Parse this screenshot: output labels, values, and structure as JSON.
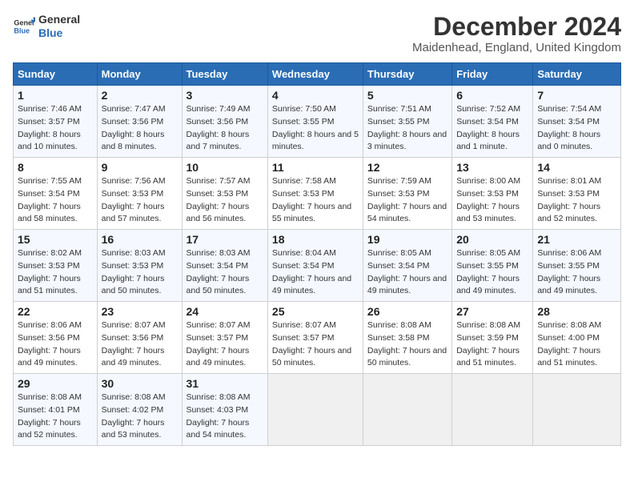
{
  "logo": {
    "line1": "General",
    "line2": "Blue"
  },
  "title": "December 2024",
  "subtitle": "Maidenhead, England, United Kingdom",
  "headers": [
    "Sunday",
    "Monday",
    "Tuesday",
    "Wednesday",
    "Thursday",
    "Friday",
    "Saturday"
  ],
  "weeks": [
    [
      {
        "day": "1",
        "sunrise": "7:46 AM",
        "sunset": "3:57 PM",
        "daylight": "8 hours and 10 minutes."
      },
      {
        "day": "2",
        "sunrise": "7:47 AM",
        "sunset": "3:56 PM",
        "daylight": "8 hours and 8 minutes."
      },
      {
        "day": "3",
        "sunrise": "7:49 AM",
        "sunset": "3:56 PM",
        "daylight": "8 hours and 7 minutes."
      },
      {
        "day": "4",
        "sunrise": "7:50 AM",
        "sunset": "3:55 PM",
        "daylight": "8 hours and 5 minutes."
      },
      {
        "day": "5",
        "sunrise": "7:51 AM",
        "sunset": "3:55 PM",
        "daylight": "8 hours and 3 minutes."
      },
      {
        "day": "6",
        "sunrise": "7:52 AM",
        "sunset": "3:54 PM",
        "daylight": "8 hours and 1 minute."
      },
      {
        "day": "7",
        "sunrise": "7:54 AM",
        "sunset": "3:54 PM",
        "daylight": "8 hours and 0 minutes."
      }
    ],
    [
      {
        "day": "8",
        "sunrise": "7:55 AM",
        "sunset": "3:54 PM",
        "daylight": "7 hours and 58 minutes."
      },
      {
        "day": "9",
        "sunrise": "7:56 AM",
        "sunset": "3:53 PM",
        "daylight": "7 hours and 57 minutes."
      },
      {
        "day": "10",
        "sunrise": "7:57 AM",
        "sunset": "3:53 PM",
        "daylight": "7 hours and 56 minutes."
      },
      {
        "day": "11",
        "sunrise": "7:58 AM",
        "sunset": "3:53 PM",
        "daylight": "7 hours and 55 minutes."
      },
      {
        "day": "12",
        "sunrise": "7:59 AM",
        "sunset": "3:53 PM",
        "daylight": "7 hours and 54 minutes."
      },
      {
        "day": "13",
        "sunrise": "8:00 AM",
        "sunset": "3:53 PM",
        "daylight": "7 hours and 53 minutes."
      },
      {
        "day": "14",
        "sunrise": "8:01 AM",
        "sunset": "3:53 PM",
        "daylight": "7 hours and 52 minutes."
      }
    ],
    [
      {
        "day": "15",
        "sunrise": "8:02 AM",
        "sunset": "3:53 PM",
        "daylight": "7 hours and 51 minutes."
      },
      {
        "day": "16",
        "sunrise": "8:03 AM",
        "sunset": "3:53 PM",
        "daylight": "7 hours and 50 minutes."
      },
      {
        "day": "17",
        "sunrise": "8:03 AM",
        "sunset": "3:54 PM",
        "daylight": "7 hours and 50 minutes."
      },
      {
        "day": "18",
        "sunrise": "8:04 AM",
        "sunset": "3:54 PM",
        "daylight": "7 hours and 49 minutes."
      },
      {
        "day": "19",
        "sunrise": "8:05 AM",
        "sunset": "3:54 PM",
        "daylight": "7 hours and 49 minutes."
      },
      {
        "day": "20",
        "sunrise": "8:05 AM",
        "sunset": "3:55 PM",
        "daylight": "7 hours and 49 minutes."
      },
      {
        "day": "21",
        "sunrise": "8:06 AM",
        "sunset": "3:55 PM",
        "daylight": "7 hours and 49 minutes."
      }
    ],
    [
      {
        "day": "22",
        "sunrise": "8:06 AM",
        "sunset": "3:56 PM",
        "daylight": "7 hours and 49 minutes."
      },
      {
        "day": "23",
        "sunrise": "8:07 AM",
        "sunset": "3:56 PM",
        "daylight": "7 hours and 49 minutes."
      },
      {
        "day": "24",
        "sunrise": "8:07 AM",
        "sunset": "3:57 PM",
        "daylight": "7 hours and 49 minutes."
      },
      {
        "day": "25",
        "sunrise": "8:07 AM",
        "sunset": "3:57 PM",
        "daylight": "7 hours and 50 minutes."
      },
      {
        "day": "26",
        "sunrise": "8:08 AM",
        "sunset": "3:58 PM",
        "daylight": "7 hours and 50 minutes."
      },
      {
        "day": "27",
        "sunrise": "8:08 AM",
        "sunset": "3:59 PM",
        "daylight": "7 hours and 51 minutes."
      },
      {
        "day": "28",
        "sunrise": "8:08 AM",
        "sunset": "4:00 PM",
        "daylight": "7 hours and 51 minutes."
      }
    ],
    [
      {
        "day": "29",
        "sunrise": "8:08 AM",
        "sunset": "4:01 PM",
        "daylight": "7 hours and 52 minutes."
      },
      {
        "day": "30",
        "sunrise": "8:08 AM",
        "sunset": "4:02 PM",
        "daylight": "7 hours and 53 minutes."
      },
      {
        "day": "31",
        "sunrise": "8:08 AM",
        "sunset": "4:03 PM",
        "daylight": "7 hours and 54 minutes."
      },
      null,
      null,
      null,
      null
    ]
  ]
}
